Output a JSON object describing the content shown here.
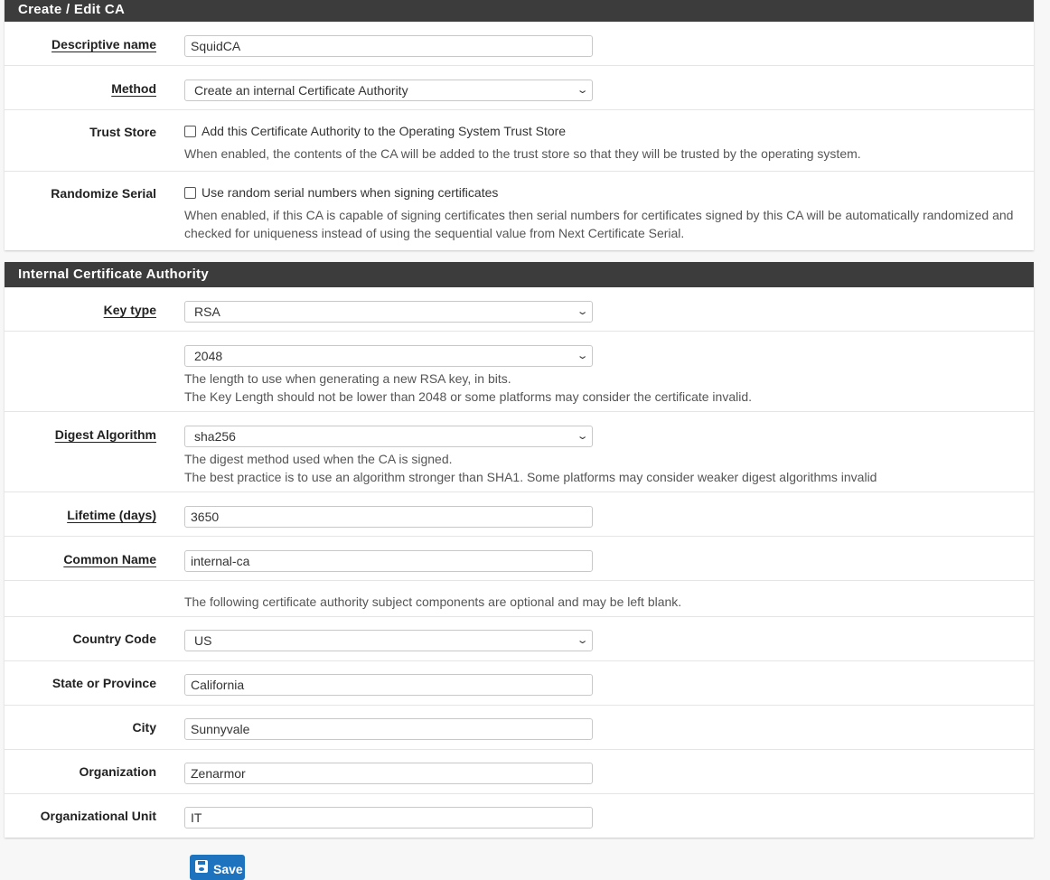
{
  "panel_ca": {
    "title": "Create / Edit CA",
    "descriptive_name": {
      "label": "Descriptive name",
      "value": "SquidCA"
    },
    "method": {
      "label": "Method",
      "value": "Create an internal Certificate Authority"
    },
    "trust_store": {
      "label": "Trust Store",
      "checkbox_label": "Add this Certificate Authority to the Operating System Trust Store",
      "checked": false,
      "help": "When enabled, the contents of the CA will be added to the trust store so that they will be trusted by the operating system."
    },
    "randomize_serial": {
      "label": "Randomize Serial",
      "checkbox_label": "Use random serial numbers when signing certificates",
      "checked": false,
      "help_line1": "When enabled, if this CA is capable of signing certificates then serial numbers for certificates signed by this CA will be automatically randomized and",
      "help_line2": "checked for uniqueness instead of using the sequential value from Next Certificate Serial."
    }
  },
  "panel_internal": {
    "title": "Internal Certificate Authority",
    "key_type": {
      "label": "Key type",
      "value": "RSA"
    },
    "key_length": {
      "value": "2048",
      "help_line1": "The length to use when generating a new RSA key, in bits.",
      "help_line2": "The Key Length should not be lower than 2048 or some platforms may consider the certificate invalid."
    },
    "digest": {
      "label": "Digest Algorithm",
      "value": "sha256",
      "help_line1": "The digest method used when the CA is signed.",
      "help_line2": "The best practice is to use an algorithm stronger than SHA1. Some platforms may consider weaker digest algorithms invalid"
    },
    "lifetime": {
      "label": "Lifetime (days)",
      "value": "3650"
    },
    "common_name": {
      "label": "Common Name",
      "value": "internal-ca"
    },
    "optional_note": "The following certificate authority subject components are optional and may be left blank.",
    "country": {
      "label": "Country Code",
      "value": "US"
    },
    "state": {
      "label": "State or Province",
      "value": "California"
    },
    "city": {
      "label": "City",
      "value": "Sunnyvale"
    },
    "organization": {
      "label": "Organization",
      "value": "Zenarmor"
    },
    "org_unit": {
      "label": "Organizational Unit",
      "value": "IT"
    }
  },
  "save_button": {
    "label": "Save",
    "icon": "floppy-disk-icon",
    "color": "#1e73be"
  },
  "colors": {
    "heading_bg": "#3c3c3c",
    "accent": "#1e73be"
  }
}
